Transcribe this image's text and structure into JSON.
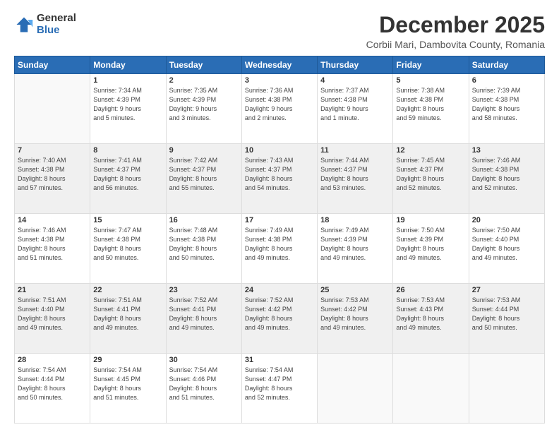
{
  "logo": {
    "general": "General",
    "blue": "Blue"
  },
  "header": {
    "title": "December 2025",
    "subtitle": "Corbii Mari, Dambovita County, Romania"
  },
  "weekdays": [
    "Sunday",
    "Monday",
    "Tuesday",
    "Wednesday",
    "Thursday",
    "Friday",
    "Saturday"
  ],
  "weeks": [
    [
      {
        "day": "",
        "info": ""
      },
      {
        "day": "1",
        "info": "Sunrise: 7:34 AM\nSunset: 4:39 PM\nDaylight: 9 hours\nand 5 minutes."
      },
      {
        "day": "2",
        "info": "Sunrise: 7:35 AM\nSunset: 4:39 PM\nDaylight: 9 hours\nand 3 minutes."
      },
      {
        "day": "3",
        "info": "Sunrise: 7:36 AM\nSunset: 4:38 PM\nDaylight: 9 hours\nand 2 minutes."
      },
      {
        "day": "4",
        "info": "Sunrise: 7:37 AM\nSunset: 4:38 PM\nDaylight: 9 hours\nand 1 minute."
      },
      {
        "day": "5",
        "info": "Sunrise: 7:38 AM\nSunset: 4:38 PM\nDaylight: 8 hours\nand 59 minutes."
      },
      {
        "day": "6",
        "info": "Sunrise: 7:39 AM\nSunset: 4:38 PM\nDaylight: 8 hours\nand 58 minutes."
      }
    ],
    [
      {
        "day": "7",
        "info": "Sunrise: 7:40 AM\nSunset: 4:38 PM\nDaylight: 8 hours\nand 57 minutes."
      },
      {
        "day": "8",
        "info": "Sunrise: 7:41 AM\nSunset: 4:37 PM\nDaylight: 8 hours\nand 56 minutes."
      },
      {
        "day": "9",
        "info": "Sunrise: 7:42 AM\nSunset: 4:37 PM\nDaylight: 8 hours\nand 55 minutes."
      },
      {
        "day": "10",
        "info": "Sunrise: 7:43 AM\nSunset: 4:37 PM\nDaylight: 8 hours\nand 54 minutes."
      },
      {
        "day": "11",
        "info": "Sunrise: 7:44 AM\nSunset: 4:37 PM\nDaylight: 8 hours\nand 53 minutes."
      },
      {
        "day": "12",
        "info": "Sunrise: 7:45 AM\nSunset: 4:37 PM\nDaylight: 8 hours\nand 52 minutes."
      },
      {
        "day": "13",
        "info": "Sunrise: 7:46 AM\nSunset: 4:38 PM\nDaylight: 8 hours\nand 52 minutes."
      }
    ],
    [
      {
        "day": "14",
        "info": "Sunrise: 7:46 AM\nSunset: 4:38 PM\nDaylight: 8 hours\nand 51 minutes."
      },
      {
        "day": "15",
        "info": "Sunrise: 7:47 AM\nSunset: 4:38 PM\nDaylight: 8 hours\nand 50 minutes."
      },
      {
        "day": "16",
        "info": "Sunrise: 7:48 AM\nSunset: 4:38 PM\nDaylight: 8 hours\nand 50 minutes."
      },
      {
        "day": "17",
        "info": "Sunrise: 7:49 AM\nSunset: 4:38 PM\nDaylight: 8 hours\nand 49 minutes."
      },
      {
        "day": "18",
        "info": "Sunrise: 7:49 AM\nSunset: 4:39 PM\nDaylight: 8 hours\nand 49 minutes."
      },
      {
        "day": "19",
        "info": "Sunrise: 7:50 AM\nSunset: 4:39 PM\nDaylight: 8 hours\nand 49 minutes."
      },
      {
        "day": "20",
        "info": "Sunrise: 7:50 AM\nSunset: 4:40 PM\nDaylight: 8 hours\nand 49 minutes."
      }
    ],
    [
      {
        "day": "21",
        "info": "Sunrise: 7:51 AM\nSunset: 4:40 PM\nDaylight: 8 hours\nand 49 minutes."
      },
      {
        "day": "22",
        "info": "Sunrise: 7:51 AM\nSunset: 4:41 PM\nDaylight: 8 hours\nand 49 minutes."
      },
      {
        "day": "23",
        "info": "Sunrise: 7:52 AM\nSunset: 4:41 PM\nDaylight: 8 hours\nand 49 minutes."
      },
      {
        "day": "24",
        "info": "Sunrise: 7:52 AM\nSunset: 4:42 PM\nDaylight: 8 hours\nand 49 minutes."
      },
      {
        "day": "25",
        "info": "Sunrise: 7:53 AM\nSunset: 4:42 PM\nDaylight: 8 hours\nand 49 minutes."
      },
      {
        "day": "26",
        "info": "Sunrise: 7:53 AM\nSunset: 4:43 PM\nDaylight: 8 hours\nand 49 minutes."
      },
      {
        "day": "27",
        "info": "Sunrise: 7:53 AM\nSunset: 4:44 PM\nDaylight: 8 hours\nand 50 minutes."
      }
    ],
    [
      {
        "day": "28",
        "info": "Sunrise: 7:54 AM\nSunset: 4:44 PM\nDaylight: 8 hours\nand 50 minutes."
      },
      {
        "day": "29",
        "info": "Sunrise: 7:54 AM\nSunset: 4:45 PM\nDaylight: 8 hours\nand 51 minutes."
      },
      {
        "day": "30",
        "info": "Sunrise: 7:54 AM\nSunset: 4:46 PM\nDaylight: 8 hours\nand 51 minutes."
      },
      {
        "day": "31",
        "info": "Sunrise: 7:54 AM\nSunset: 4:47 PM\nDaylight: 8 hours\nand 52 minutes."
      },
      {
        "day": "",
        "info": ""
      },
      {
        "day": "",
        "info": ""
      },
      {
        "day": "",
        "info": ""
      }
    ]
  ]
}
